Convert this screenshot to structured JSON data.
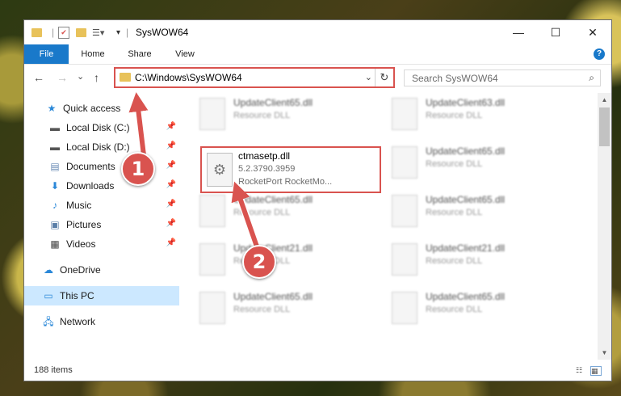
{
  "window": {
    "title": "SysWOW64",
    "controls": {
      "minimize": "—",
      "maximize": "☐",
      "close": "✕"
    }
  },
  "ribbon": {
    "tabs": [
      "File",
      "Home",
      "Share",
      "View"
    ],
    "help": "?"
  },
  "navigation": {
    "back": "←",
    "forward": "→",
    "recent": "⌄",
    "up": "↑",
    "address": "C:\\Windows\\SysWOW64",
    "search_placeholder": "Search SysWOW64"
  },
  "sidebar": {
    "items": [
      {
        "label": "Quick access",
        "icon": "star-icon",
        "pinned": false
      },
      {
        "label": "Local Disk (C:)",
        "icon": "drive-icon",
        "pinned": true
      },
      {
        "label": "Local Disk (D:)",
        "icon": "drive-icon",
        "pinned": true
      },
      {
        "label": "Documents",
        "icon": "documents-icon",
        "pinned": true
      },
      {
        "label": "Downloads",
        "icon": "download-icon",
        "pinned": true
      },
      {
        "label": "Music",
        "icon": "music-icon",
        "pinned": true
      },
      {
        "label": "Pictures",
        "icon": "pictures-icon",
        "pinned": true
      },
      {
        "label": "Videos",
        "icon": "videos-icon",
        "pinned": true
      },
      {
        "label": "OneDrive",
        "icon": "cloud-icon",
        "pinned": false
      },
      {
        "label": "This PC",
        "icon": "computer-icon",
        "pinned": false,
        "selected": true
      },
      {
        "label": "Network",
        "icon": "network-icon",
        "pinned": false
      }
    ]
  },
  "files": {
    "highlighted": {
      "name": "ctmasetp.dll",
      "version": "5.2.3790.3959",
      "description": "RocketPort RocketMo..."
    },
    "blurred": [
      {
        "name": "UpdateClient65.dll",
        "desc": "Resource DLL"
      },
      {
        "name": "UpdateClient63.dll",
        "desc": "Resource DLL"
      },
      {
        "name": "UpdateClient65.dll",
        "desc": "Resource DLL"
      },
      {
        "name": "UpdateClient65.dll",
        "desc": "Resource DLL"
      },
      {
        "name": "UpdateClient65.dll",
        "desc": "Resource DLL"
      },
      {
        "name": "UpdateClient21.dll",
        "desc": "Resource DLL"
      },
      {
        "name": "UpdateClient21.dll",
        "desc": "Resource DLL"
      },
      {
        "name": "UpdateClient65.dll",
        "desc": "Resource DLL"
      },
      {
        "name": "UpdateClient65.dll",
        "desc": "Resource DLL"
      }
    ]
  },
  "status": {
    "item_count": "188 items"
  },
  "callouts": {
    "step1": "1",
    "step2": "2",
    "color": "#d9534f"
  }
}
